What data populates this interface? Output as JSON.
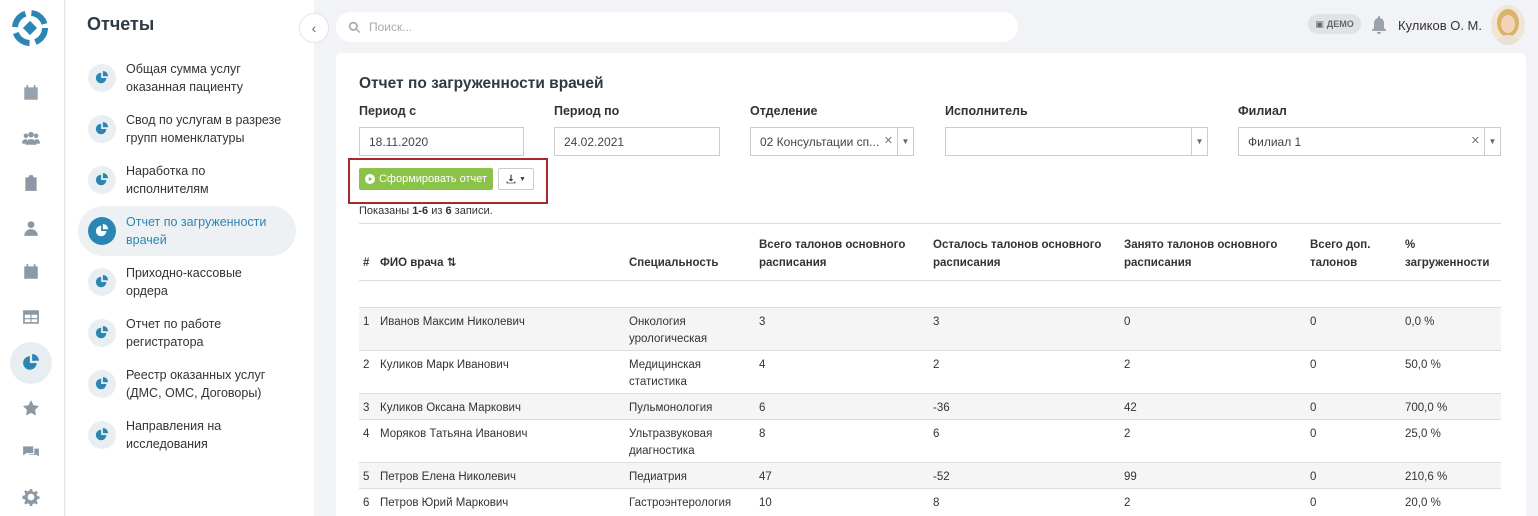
{
  "rail": {
    "items": [
      "calendar-icon",
      "users-icon",
      "clipboard-icon",
      "doctor-icon",
      "schedule-icon",
      "table-icon",
      "reports-icon",
      "star-icon",
      "chat-icon",
      "gear-icon"
    ],
    "accent": "#2b86b3"
  },
  "sidebar": {
    "title": "Отчеты",
    "items": [
      {
        "label_line1": "Общая сумма услуг",
        "label_line2": "оказанная пациенту"
      },
      {
        "label_line1": "Свод по услугам в разрезе",
        "label_line2": "групп номенклатуры"
      },
      {
        "label_line1": "Наработка по",
        "label_line2": "исполнителям"
      },
      {
        "label_line1": "Отчет по загруженности",
        "label_line2": "врачей"
      },
      {
        "label_line1": "Приходно-кассовые",
        "label_line2": "ордера"
      },
      {
        "label_line1": "Отчет по работе",
        "label_line2": "регистратора"
      },
      {
        "label_line1": "Реестр оказанных услуг",
        "label_line2": "(ДМС, ОМС, Договоры)"
      },
      {
        "label_line1": "Направления на",
        "label_line2": "исследования"
      }
    ]
  },
  "topbar": {
    "search_placeholder": "Поиск...",
    "demo_badge": "ДЕМО",
    "user_name": "Куликов О. М."
  },
  "report": {
    "title": "Отчет по загруженности врачей",
    "filters": {
      "period_from_label": "Период с",
      "period_from_value": "18.11.2020",
      "period_to_label": "Период по",
      "period_to_value": "24.02.2021",
      "department_label": "Отделение",
      "department_value": "02 Консультации сп...",
      "performer_label": "Исполнитель",
      "performer_value": "",
      "branch_label": "Филиал",
      "branch_value": "Филиал 1"
    },
    "generate_label": "Сформировать отчет",
    "records_prefix": "Показаны ",
    "records_range": "1-6",
    "records_mid": " из ",
    "records_total": "6",
    "records_suffix": " записи.",
    "columns": {
      "num": "#",
      "name": "ФИО врача",
      "spec": "Специальность",
      "total1": "Всего талонов основного",
      "total2": "расписания",
      "left1": "Осталось талонов основного",
      "left2": "расписания",
      "busy1": "Занято талонов основного",
      "busy2": "расписания",
      "extra1": "Всего доп.",
      "extra2": "талонов",
      "pct1": "%",
      "pct2": "загруженности"
    },
    "rows": [
      {
        "num": "1",
        "name": "Иванов Максим Николевич",
        "spec1": "Онкология",
        "spec2": "урологическая",
        "total": "3",
        "left": "3",
        "busy": "0",
        "extra": "0",
        "pct": "0,0 %"
      },
      {
        "num": "2",
        "name": "Куликов Марк Иванович",
        "spec1": "Медицинская",
        "spec2": "статистика",
        "total": "4",
        "left": "2",
        "busy": "2",
        "extra": "0",
        "pct": "50,0 %"
      },
      {
        "num": "3",
        "name": "Куликов Оксана Маркович",
        "spec1": "Пульмонология",
        "spec2": "",
        "total": "6",
        "left": "-36",
        "busy": "42",
        "extra": "0",
        "pct": "700,0 %"
      },
      {
        "num": "4",
        "name": "Моряков Татьяна Иванович",
        "spec1": "Ультразвуковая",
        "spec2": "диагностика",
        "total": "8",
        "left": "6",
        "busy": "2",
        "extra": "0",
        "pct": "25,0 %"
      },
      {
        "num": "5",
        "name": "Петров Елена Николевич",
        "spec1": "Педиатрия",
        "spec2": "",
        "total": "47",
        "left": "-52",
        "busy": "99",
        "extra": "0",
        "pct": "210,6 %"
      },
      {
        "num": "6",
        "name": "Петров Юрий Маркович",
        "spec1": "Гастроэнтерология",
        "spec2": "",
        "total": "10",
        "left": "8",
        "busy": "2",
        "extra": "0",
        "pct": "20,0 %"
      }
    ]
  }
}
